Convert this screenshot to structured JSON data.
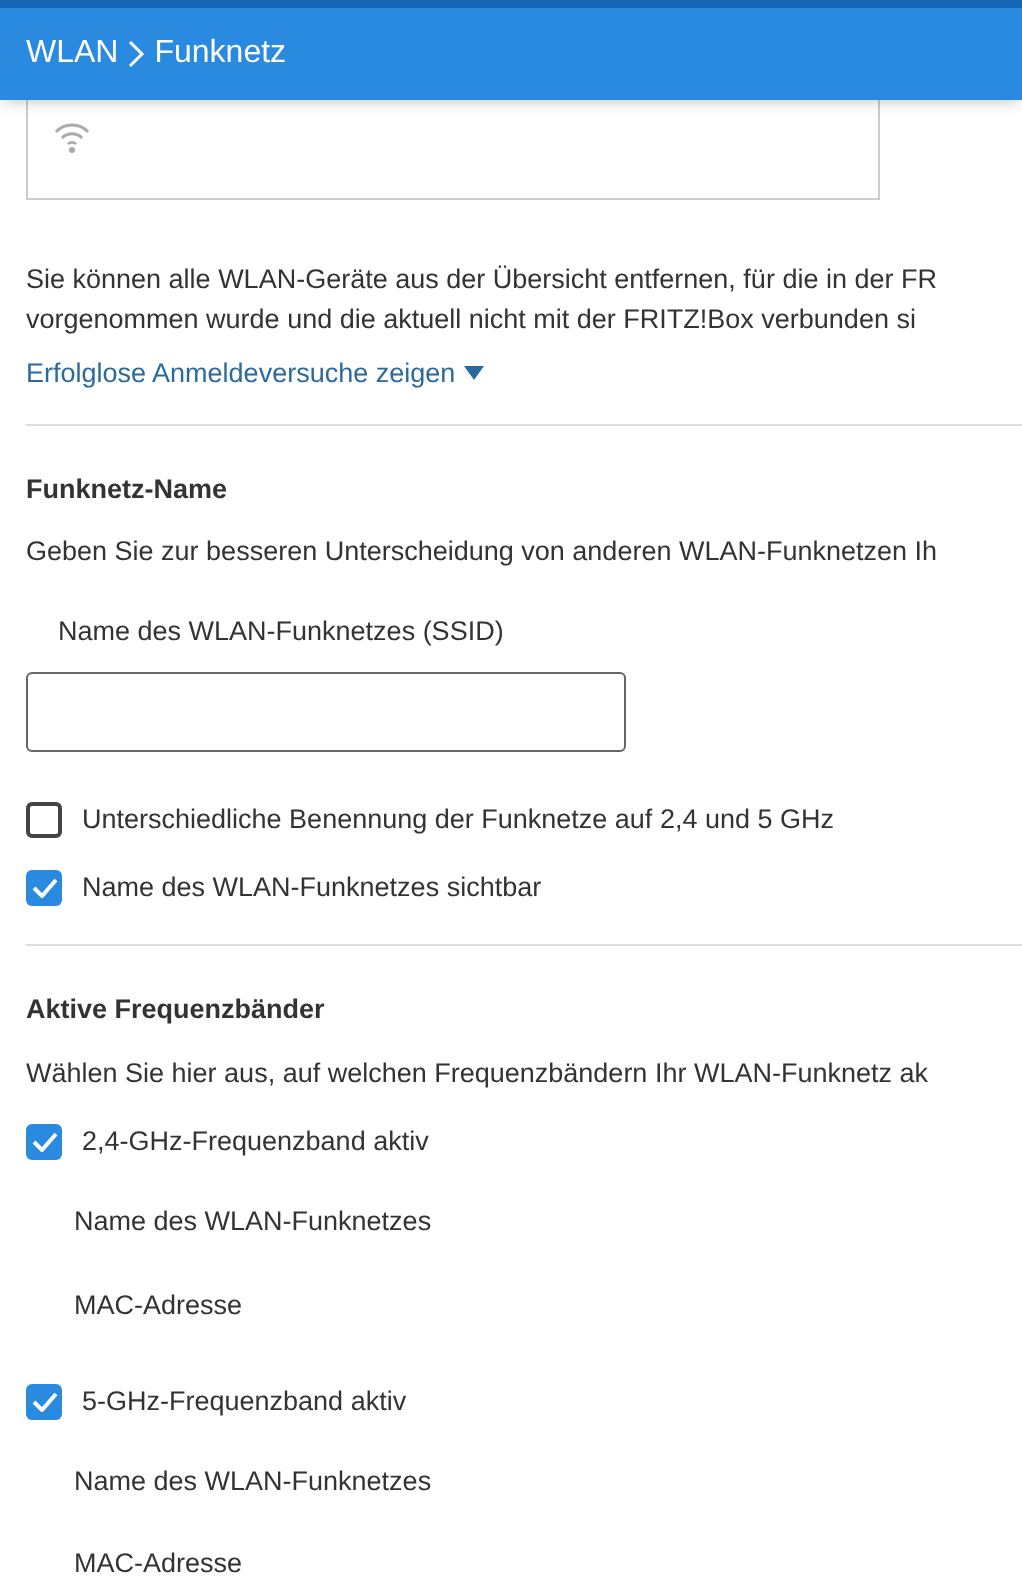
{
  "header": {
    "breadcrumb": [
      {
        "label": "WLAN"
      },
      {
        "label": "Funknetz"
      }
    ]
  },
  "info_text": [
    "Sie können alle WLAN-Geräte aus der Übersicht entfernen, für die in der FR",
    "vorgenommen wurde und die aktuell nicht mit der FRITZ!Box verbunden si"
  ],
  "toggle_link": {
    "label": "Erfolglose Anmeldeversuche zeigen",
    "expanded": false
  },
  "network_name": {
    "heading": "Funknetz-Name",
    "description": "Geben Sie zur besseren Unterscheidung von anderen WLAN-Funknetzen Ih",
    "field_label": "Name des WLAN-Funknetzes (SSID)",
    "options": [
      {
        "label": "Unterschiedliche Benennung der Funknetze auf 2,4 und 5 GHz",
        "checked": false
      },
      {
        "label": "Name des WLAN-Funknetzes sichtbar",
        "checked": true
      }
    ]
  },
  "bands": {
    "heading": "Aktive Frequenzbänder",
    "description": "Wählen Sie hier aus, auf welchen Frequenzbändern Ihr WLAN-Funknetz ak",
    "items": [
      {
        "label": "2,4-GHz-Frequenzband aktiv",
        "checked": true,
        "details": [
          "Name des WLAN-Funknetzes",
          "MAC-Adresse"
        ]
      },
      {
        "label": "5-GHz-Frequenzband aktiv",
        "checked": true,
        "details": [
          "Name des WLAN-Funknetzes",
          "MAC-Adresse"
        ]
      }
    ]
  }
}
